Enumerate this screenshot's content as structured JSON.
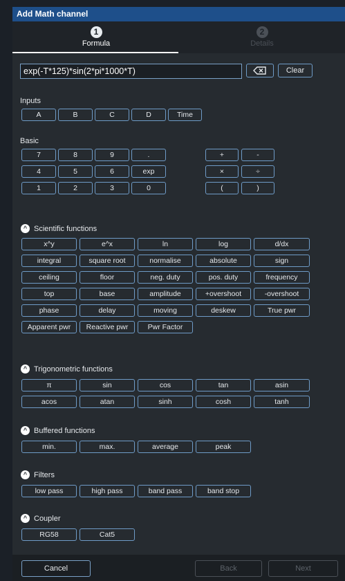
{
  "dialog": {
    "title": "Add Math channel"
  },
  "steps": [
    {
      "number": "1",
      "label": "Formula"
    },
    {
      "number": "2",
      "label": "Details"
    }
  ],
  "formula": {
    "value": "exp(-T*125)*sin(2*pi*1000*T)",
    "clear_label": "Clear",
    "backspace_icon": "backspace-icon"
  },
  "inputs": {
    "title": "Inputs",
    "buttons": [
      "A",
      "B",
      "C",
      "D",
      "Time"
    ]
  },
  "basic": {
    "title": "Basic",
    "digits": [
      "7",
      "8",
      "9",
      ".",
      "4",
      "5",
      "6",
      "exp",
      "1",
      "2",
      "3",
      "0"
    ],
    "operators": [
      "+",
      "-",
      "×",
      "÷",
      "(",
      ")"
    ]
  },
  "scientific": {
    "title": "Scientific functions",
    "buttons": [
      "x^y",
      "e^x",
      "ln",
      "log",
      "d/dx",
      "integral",
      "square root",
      "normalise",
      "absolute",
      "sign",
      "ceiling",
      "floor",
      "neg. duty",
      "pos. duty",
      "frequency",
      "top",
      "base",
      "amplitude",
      "+overshoot",
      "-overshoot",
      "phase",
      "delay",
      "moving",
      "deskew",
      "True pwr",
      "Apparent pwr",
      "Reactive pwr",
      "Pwr Factor"
    ]
  },
  "trigonometric": {
    "title": "Trigonometric functions",
    "buttons": [
      "π",
      "sin",
      "cos",
      "tan",
      "asin",
      "acos",
      "atan",
      "sinh",
      "cosh",
      "tanh"
    ]
  },
  "buffered": {
    "title": "Buffered functions",
    "buttons": [
      "min.",
      "max.",
      "average",
      "peak"
    ]
  },
  "filters": {
    "title": "Filters",
    "buttons": [
      "low pass",
      "high pass",
      "band pass",
      "band stop"
    ]
  },
  "coupler": {
    "title": "Coupler",
    "buttons": [
      "RG58",
      "Cat5"
    ]
  },
  "footer": {
    "cancel": "Cancel",
    "back": "Back",
    "next": "Next"
  },
  "colors": {
    "title_bar": "#1e4f8a",
    "button_border": "#6f9cc8",
    "background": "#262b30",
    "disabled": "#4b5057"
  }
}
